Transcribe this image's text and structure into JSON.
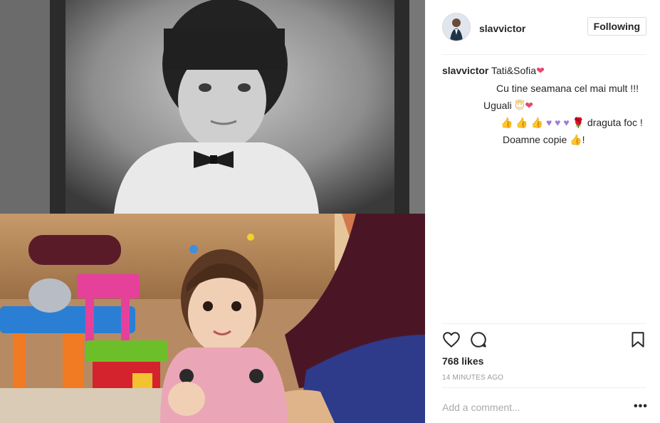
{
  "post": {
    "photo_alt": "Split photo: black-and-white portrait of a boy on top, color photo of a smiling toddler below",
    "header": {
      "username": "slavvictor",
      "follow_label": "Following"
    },
    "caption": {
      "username": "slavvictor",
      "text": "Tati&Sofia"
    },
    "comments": [
      {
        "text": "Cu tine seamana cel mai mult !!!"
      },
      {
        "text": "Uguali"
      },
      {
        "text": "draguta foc !"
      },
      {
        "text": "Doamne copie"
      }
    ],
    "likes": "768 likes",
    "time_ago": "14 MINUTES AGO",
    "add_comment_placeholder": "Add a comment...",
    "more_label": "•••"
  },
  "colors": {
    "heart": "#e8466a",
    "border": "#efefef",
    "muted": "#999999"
  },
  "icons": [
    "heart-outline-icon",
    "comment-icon",
    "bookmark-icon",
    "more-options-icon",
    "profile-avatar"
  ]
}
